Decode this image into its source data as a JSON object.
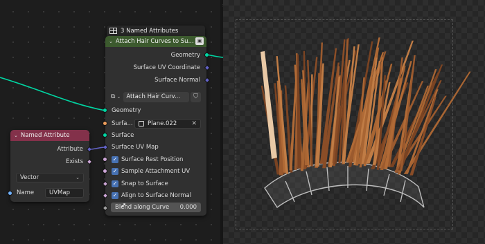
{
  "named_attributes_tag": {
    "label": "3 Named Attributes"
  },
  "attach_node": {
    "title": "Attach Hair Curves to Su...",
    "outputs": [
      "Geometry",
      "Surface UV Coordinate",
      "Surface Normal"
    ],
    "group_selector": "Attach Hair Curv...",
    "inputs": {
      "geometry": "Geometry",
      "surface_label": "Surfa...",
      "surface_object": "Plane.022",
      "surface": "Surface",
      "surface_uv_map": "Surface UV Map",
      "surface_rest_position": "Surface Rest Position",
      "sample_attachment_uv": "Sample Attachment UV",
      "snap_to_surface": "Snap to Surface",
      "align_to_surface_normal": "Align to Surface Normal",
      "blend_along_curve_label": "Blend along Curve",
      "blend_along_curve_value": "0.000"
    },
    "colors": {
      "header": "#3c5a2e"
    }
  },
  "named_attribute_node": {
    "title": "Named Attribute",
    "outputs": [
      "Attribute",
      "Exists"
    ],
    "data_type": "Vector",
    "name_label": "Name",
    "name_value": "UVMap",
    "colors": {
      "header": "#83314a"
    }
  },
  "colors": {
    "geometry_socket": "#00d6a3",
    "vector_socket": "#6363c7",
    "boolean_socket": "#cca6d6",
    "checkbox": "#4772b3",
    "hair": "#9b5a2e"
  }
}
